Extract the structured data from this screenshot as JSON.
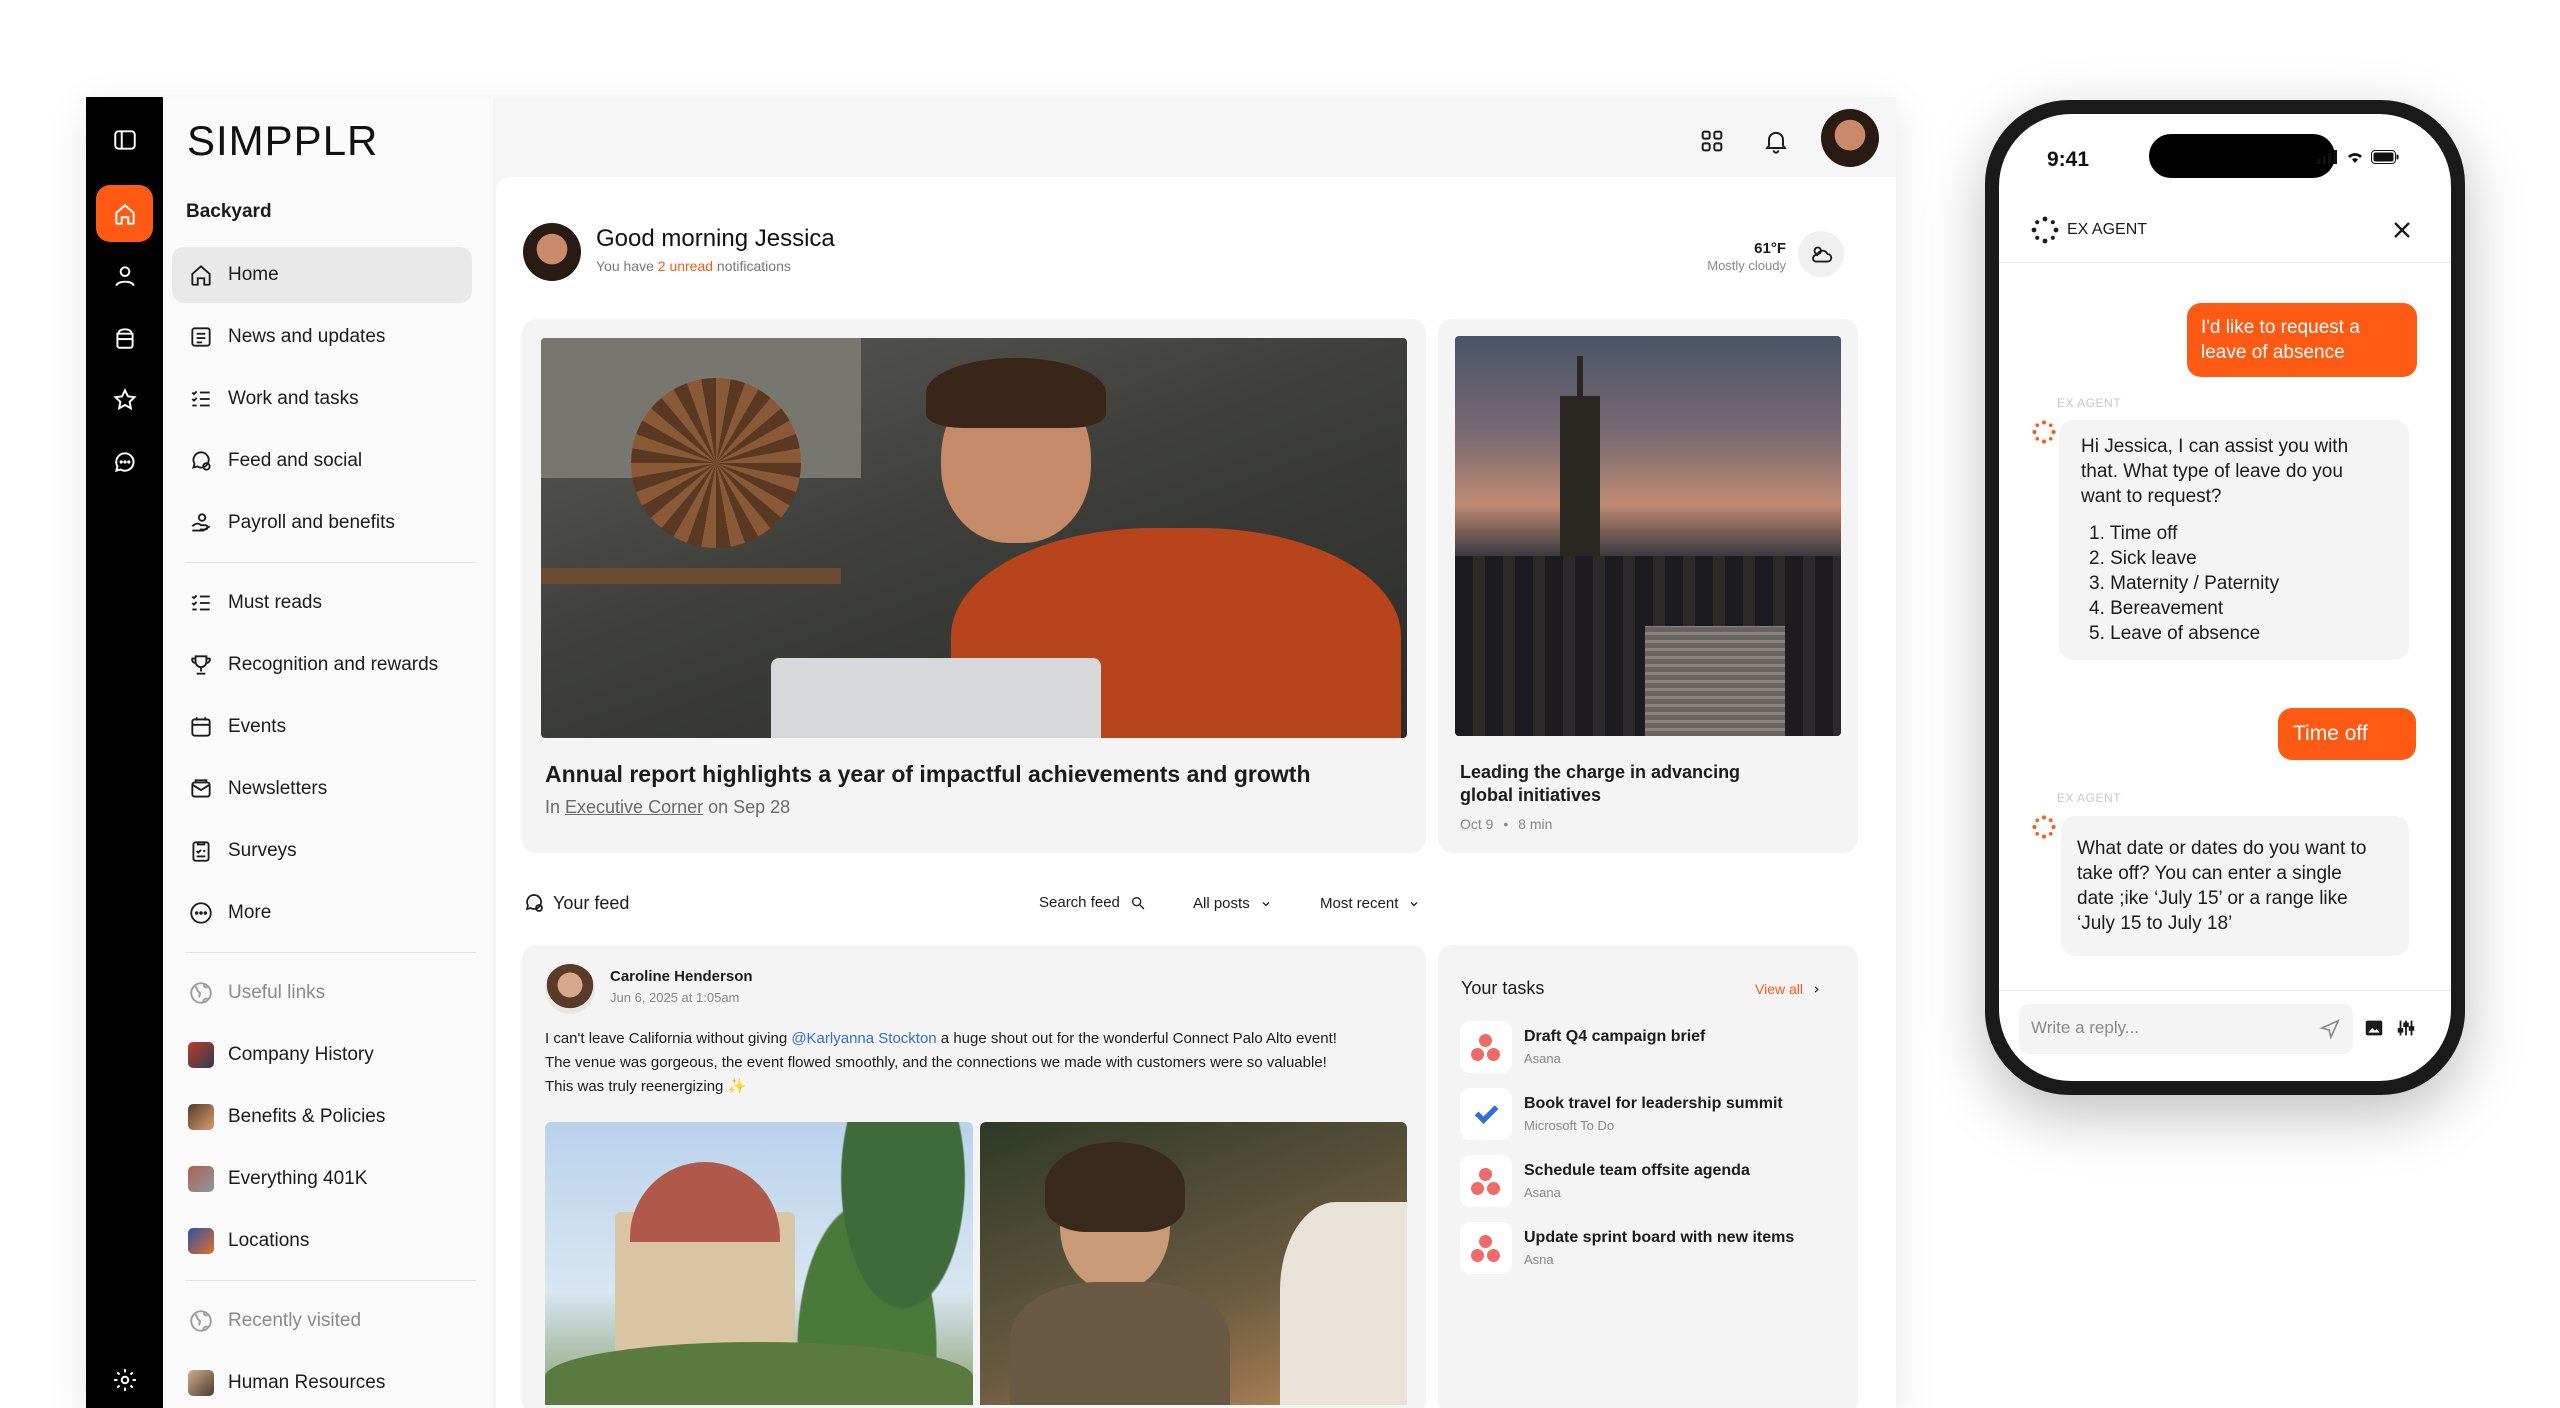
{
  "brand": {
    "logo": "SIMPPLR"
  },
  "sidebar": {
    "section_title": "Backyard",
    "items": [
      {
        "label": "Home",
        "icon": "home-icon"
      },
      {
        "label": "News and updates",
        "icon": "news-icon"
      },
      {
        "label": "Work and tasks",
        "icon": "tasks-icon"
      },
      {
        "label": "Feed and social",
        "icon": "feed-icon"
      },
      {
        "label": "Payroll and benefits",
        "icon": "payroll-icon"
      },
      {
        "label": "Must reads",
        "icon": "must-reads-icon"
      },
      {
        "label": "Recognition and rewards",
        "icon": "trophy-icon"
      },
      {
        "label": "Events",
        "icon": "calendar-icon"
      },
      {
        "label": "Newsletters",
        "icon": "newsletter-icon"
      },
      {
        "label": "Surveys",
        "icon": "survey-icon"
      },
      {
        "label": "More",
        "icon": "more-icon"
      }
    ],
    "useful_links_title": "Useful links",
    "useful_links": [
      {
        "label": "Company History"
      },
      {
        "label": "Benefits & Policies"
      },
      {
        "label": "Everything 401K"
      },
      {
        "label": "Locations"
      }
    ],
    "recent_title": "Recently visited",
    "recent": [
      {
        "label": "Human Resources"
      }
    ]
  },
  "greeting": {
    "title": "Good morning Jessica",
    "subtitle_pre": "You have ",
    "subtitle_highlight": "2 unread",
    "subtitle_post": " notifications",
    "temp": "61°F",
    "weather": "Mostly cloudy"
  },
  "featured": {
    "title": "Annual report highlights a year of impactful achievements and growth",
    "meta_in": "In",
    "meta_link": "Executive Corner",
    "meta_date": "on Sep 28"
  },
  "secondary": {
    "title_line1": "Leading the charge in advancing",
    "title_line2": "global initiatives",
    "date": "Oct 9",
    "read_time": "8 min"
  },
  "feed": {
    "title": "Your feed",
    "search": "Search feed",
    "filter": "All posts",
    "sort": "Most recent",
    "post": {
      "author": "Caroline Henderson",
      "date": "Jun 6, 2025 at 1:05am",
      "text_pre": "I can't leave California without giving ",
      "mention": "@Karlyanna Stockton",
      "text_post": " a huge shout out for the wonderful Connect Palo Alto event!",
      "line2": "The venue was gorgeous, the event flowed smoothly, and the connections we made with customers were so valuable!",
      "line3": "This was truly reenergizing ✨"
    }
  },
  "tasks": {
    "title": "Your tasks",
    "view_all": "View all",
    "items": [
      {
        "title": "Draft Q4 campaign brief",
        "source": "Asana"
      },
      {
        "title": "Book travel for leadership summit",
        "source": "Microsoft To Do"
      },
      {
        "title": "Schedule team offsite agenda",
        "source": "Asana"
      },
      {
        "title": "Update sprint board with new items",
        "source": "Asna"
      }
    ]
  },
  "phone": {
    "time": "9:41",
    "agent_name": "EX AGENT",
    "user_msg1_l1": "I'd like to request a",
    "user_msg1_l2": "leave of absence",
    "agent_tag": "EX AGENT",
    "agent_msg1": [
      "Hi Jessica, I can assist you with",
      "that. What type of leave do you",
      "want to request?"
    ],
    "agent_options": [
      "1. Time off",
      "2. Sick leave",
      "3. Maternity / Paternity",
      "4. Bereavement",
      "5. Leave of absence"
    ],
    "user_msg2": "Time off",
    "agent_msg2": [
      "What date or dates do you want to",
      "take off? You can enter a single",
      "date ;ike ‘July 15’ or a range like",
      "‘July 15 to July 18’"
    ],
    "reply_placeholder": "Write a reply..."
  },
  "colors": {
    "accent": "#ff5a14",
    "rail": "#000000",
    "link": "#2f6fd6"
  }
}
